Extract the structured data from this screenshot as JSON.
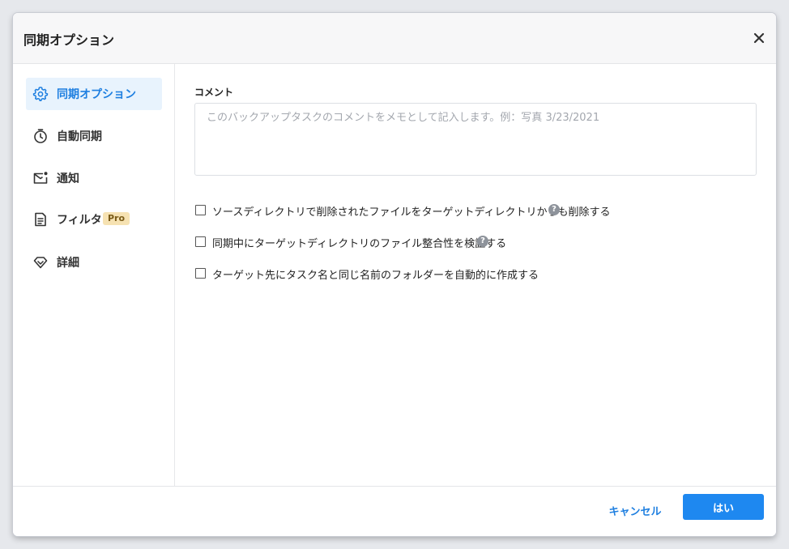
{
  "dialog": {
    "title": "同期オプション"
  },
  "sidebar": {
    "items": [
      {
        "label": "同期オプション",
        "icon": "gear-icon",
        "active": true
      },
      {
        "label": "自動同期",
        "icon": "stopwatch-icon"
      },
      {
        "label": "通知",
        "icon": "mail-notification-icon"
      },
      {
        "label": "フィルタ",
        "icon": "document-filter-icon",
        "badge": "Pro"
      },
      {
        "label": "詳細",
        "icon": "diamond-icon"
      }
    ]
  },
  "main": {
    "comment_label": "コメント",
    "comment_value": "",
    "comment_placeholder": "このバックアップタスクのコメントをメモとして記入します。例：写真 3/23/2021",
    "options": [
      {
        "label": "ソースディレクトリで削除されたファイルをターゲットディレクトリからも削除する",
        "checked": false,
        "help": "?"
      },
      {
        "label": "同期中にターゲットディレクトリのファイル整合性を検証する",
        "checked": false,
        "help": "?"
      },
      {
        "label": "ターゲット先にタスク名と同じ名前のフォルダーを自動的に作成する",
        "checked": false
      }
    ]
  },
  "footer": {
    "cancel_label": "キャンセル",
    "ok_label": "はい"
  },
  "colors": {
    "accent": "#1e88f0",
    "active_bg": "#e8f3fd",
    "pro_badge_bg": "#f6e2b2"
  }
}
